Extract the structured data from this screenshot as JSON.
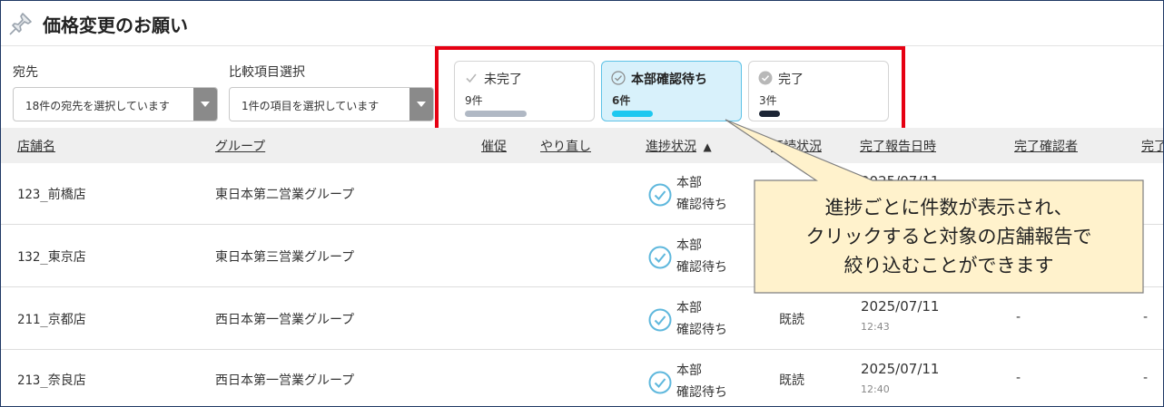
{
  "page": {
    "title": "価格変更のお願い"
  },
  "filters": {
    "destination": {
      "label": "宛先",
      "value": "18件の宛先を選択しています"
    },
    "compare": {
      "label": "比較項目選択",
      "value": "1件の項目を選択しています"
    }
  },
  "status_cards": [
    {
      "label": "未完了",
      "count": "9件",
      "icon": "check-icon",
      "bar_color": "#b0b8c4",
      "bar_fraction": 0.9,
      "active": false
    },
    {
      "label": "本部確認待ち",
      "count": "6件",
      "icon": "circle-check-icon",
      "bar_color": "#1ec8f0",
      "bar_fraction": 0.6,
      "active": true
    },
    {
      "label": "完了",
      "count": "3件",
      "icon": "circle-check-filled-icon",
      "bar_color": "#1c2535",
      "bar_fraction": 0.3,
      "active": false
    }
  ],
  "table": {
    "columns": [
      "店舗名",
      "グループ",
      "催促",
      "やり直し",
      "進捗状況",
      "既読状況",
      "完了報告日時",
      "完了確認者",
      "完了"
    ],
    "sort_indicator": "▲",
    "rows": [
      {
        "store": "123_前橋店",
        "group": "東日本第二営業グループ",
        "status_line1": "本部",
        "status_line2": "確認待ち",
        "read": "",
        "date": "2025/07/11",
        "time": "",
        "confirmer": "",
        "extra": ""
      },
      {
        "store": "132_東京店",
        "group": "東日本第三営業グループ",
        "status_line1": "本部",
        "status_line2": "確認待ち",
        "read": "",
        "date": "",
        "time": "",
        "confirmer": "",
        "extra": ""
      },
      {
        "store": "211_京都店",
        "group": "西日本第一営業グループ",
        "status_line1": "本部",
        "status_line2": "確認待ち",
        "read": "既読",
        "date": "2025/07/11",
        "time": "12:43",
        "confirmer": "-",
        "extra": "-"
      },
      {
        "store": "213_奈良店",
        "group": "西日本第一営業グループ",
        "status_line1": "本部",
        "status_line2": "確認待ち",
        "read": "既読",
        "date": "2025/07/11",
        "time": "12:40",
        "confirmer": "-",
        "extra": "-"
      }
    ]
  },
  "callout": {
    "lines": [
      "進捗ごとに件数が表示され、",
      "クリックすると対象の店舗報告で",
      "絞り込むことができます"
    ]
  },
  "colors": {
    "highlight_border": "#e60012",
    "callout_bg": "#fff2cc",
    "active_card_bg": "#d8f1fb"
  }
}
